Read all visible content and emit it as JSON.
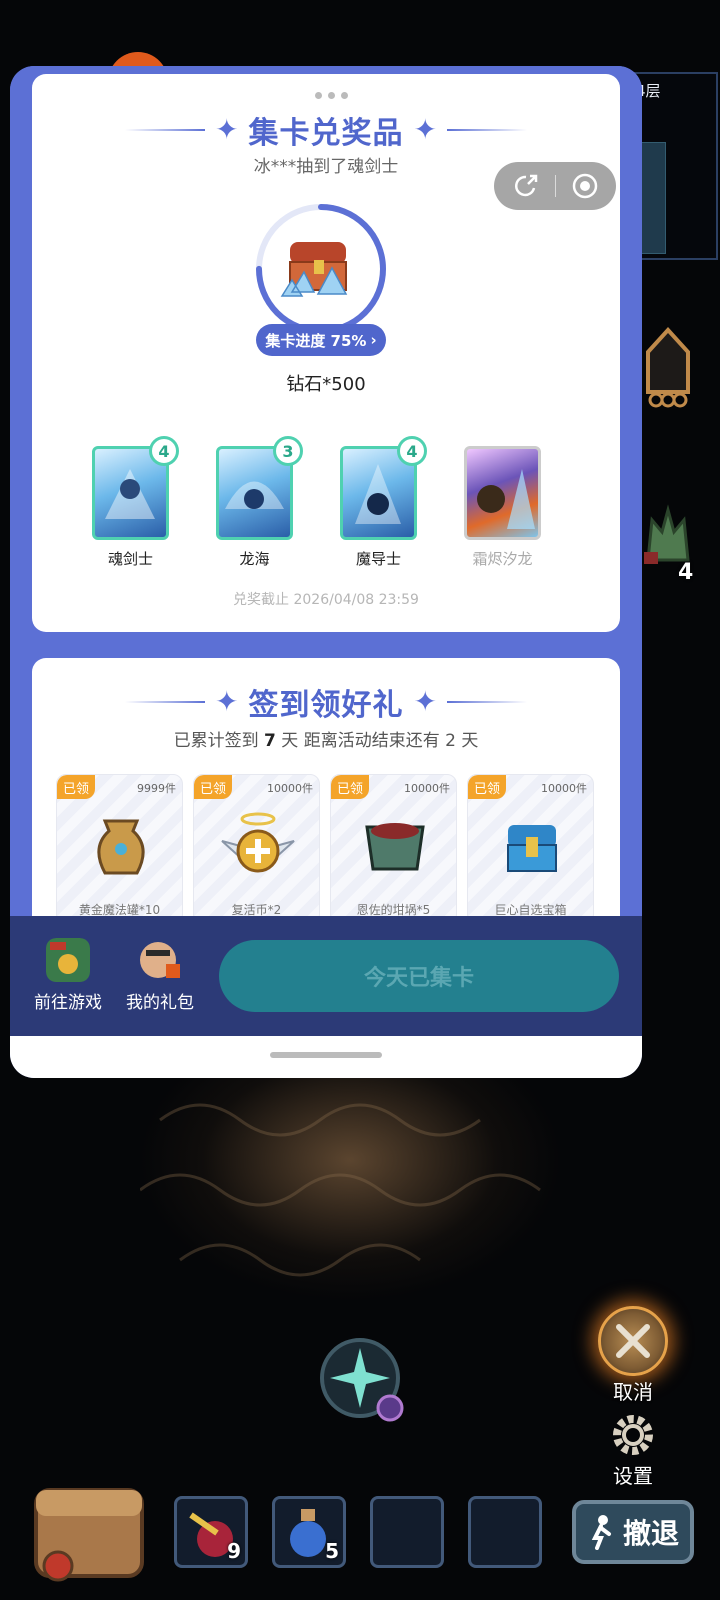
{
  "game": {
    "floor_label": "4层",
    "enemy_count": "4",
    "cancel_label": "取消",
    "settings_label": "设置",
    "retreat_label": "撤退",
    "slots": [
      {
        "name": "bomb-bundle",
        "count": "9"
      },
      {
        "name": "potion",
        "count": "5"
      },
      {
        "name": "empty",
        "count": ""
      },
      {
        "name": "empty",
        "count": ""
      }
    ]
  },
  "popup": {
    "card_exchange": {
      "title": "集卡兑奖品",
      "subtitle": "冰***抽到了魂剑士",
      "progress_label": "集卡进度 75%",
      "progress_value": 0.75,
      "prize": "钻石*500",
      "cards": [
        {
          "name": "魂剑士",
          "count": "4",
          "owned": true
        },
        {
          "name": "龙海",
          "count": "3",
          "owned": true
        },
        {
          "name": "魔导士",
          "count": "4",
          "owned": true
        },
        {
          "name": "霜烬汐龙",
          "count": "",
          "owned": false
        }
      ],
      "deadline": "兑奖截止 2026/04/08 23:59"
    },
    "signin": {
      "title": "签到领好礼",
      "subtitle_prefix": "已累计签到",
      "days": "7",
      "subtitle_middle": "天  距离活动结束还有",
      "remaining": "2",
      "subtitle_suffix": "天",
      "rewards": [
        {
          "status": "已领",
          "qty": "9999件",
          "name": "黄金魔法罐*10"
        },
        {
          "status": "已领",
          "qty": "10000件",
          "name": "复活币*2"
        },
        {
          "status": "已领",
          "qty": "10000件",
          "name": "恩佐的坩埚*5"
        },
        {
          "status": "已领",
          "qty": "10000件",
          "name": "巨心自选宝箱"
        }
      ]
    },
    "bottom": {
      "go_game": "前往游戏",
      "my_gifts": "我的礼包",
      "cta": "今天已集卡"
    }
  },
  "colors": {
    "primary": "#5c70d5",
    "teal": "#4fd1b0",
    "cta": "#23808f",
    "claimed": "#f4a42a"
  }
}
